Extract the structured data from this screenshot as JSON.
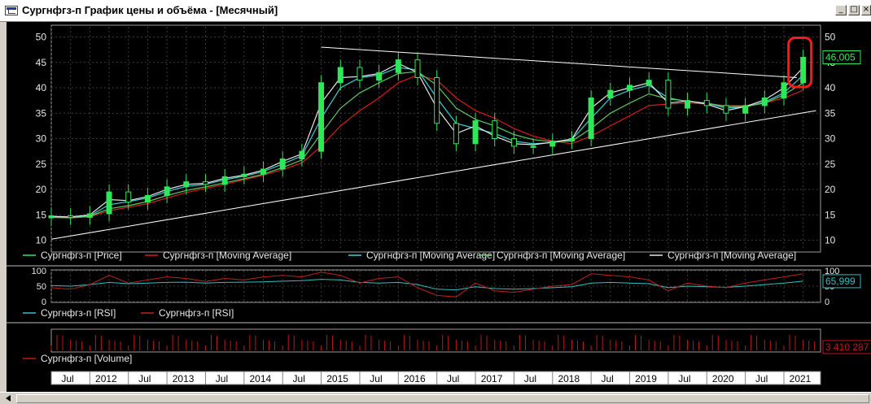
{
  "window": {
    "title": "Сургнфгз-п График цены и объёма - [Месячный]",
    "buttons": {
      "minimize": "_",
      "maximize": "□",
      "close": "×"
    }
  },
  "colors": {
    "background": "#000000",
    "grid": "#3a3a3a",
    "price": "#2ee85a",
    "ma_red": "#d81b1b",
    "ma_cyan": "#3ad0d8",
    "ma_green": "#5ec85e",
    "ma_white": "#e8e8e8",
    "trend": "#ffffff",
    "rsi_cyan": "#30c0c0",
    "rsi_red": "#c02020",
    "volume": "#c01818",
    "highlight": "#ff1a1a"
  },
  "chart_data": [
    {
      "type": "candlestick",
      "panel": "price",
      "y_ticks": [
        "50",
        "45",
        "40",
        "35",
        "30",
        "25",
        "20",
        "15",
        "10"
      ],
      "ylim": [
        8,
        52
      ],
      "grid": true,
      "last_value_label": "46,005",
      "x_dates": [
        "2011-07",
        "2011-10",
        "2012-01",
        "2012-04",
        "2012-07",
        "2012-10",
        "2013-01",
        "2013-04",
        "2013-07",
        "2013-10",
        "2014-01",
        "2014-04",
        "2014-07",
        "2014-10",
        "2015-01",
        "2015-04",
        "2015-07",
        "2015-10",
        "2016-01",
        "2016-04",
        "2016-07",
        "2016-10",
        "2017-01",
        "2017-04",
        "2017-07",
        "2017-10",
        "2018-01",
        "2018-04",
        "2018-07",
        "2018-10",
        "2019-01",
        "2019-04",
        "2019-07",
        "2019-10",
        "2020-01",
        "2020-04",
        "2020-07",
        "2020-10",
        "2021-01",
        "2021-04"
      ],
      "close": [
        14.8,
        14.5,
        15.2,
        19.5,
        17.5,
        18.8,
        20.5,
        21.5,
        21.0,
        22.5,
        23.0,
        24.0,
        26.0,
        27.5,
        41.0,
        44.0,
        41.5,
        43.0,
        45.5,
        42.0,
        33.0,
        29.0,
        33.5,
        30.0,
        28.5,
        28.5,
        29.5,
        30.0,
        38.0,
        39.5,
        40.5,
        41.5,
        36.0,
        37.5,
        36.5,
        35.0,
        36.5,
        38.0,
        41.0,
        46.0
      ],
      "series": [
        {
          "name": "Сургнфгз-п [Price]",
          "color": "#2ee85a"
        },
        {
          "name": "Сургнфгз-п [Moving Average]",
          "color": "#d81b1b",
          "values": [
            14.5,
            14.4,
            14.6,
            15.8,
            16.5,
            17.2,
            18.3,
            19.4,
            20.2,
            21.0,
            21.9,
            22.8,
            23.9,
            25.2,
            28.5,
            32.5,
            35.5,
            38.0,
            41.0,
            42.5,
            41.5,
            38.0,
            35.5,
            34.0,
            32.0,
            30.5,
            29.5,
            29.0,
            30.5,
            32.5,
            34.5,
            36.5,
            36.8,
            37.0,
            36.8,
            36.5,
            36.5,
            37.0,
            38.0,
            39.5
          ]
        },
        {
          "name": "Сургнфгз-п [Moving Average]",
          "color": "#3ad0d8",
          "values": [
            14.6,
            14.5,
            14.8,
            17.0,
            17.6,
            18.3,
            19.6,
            20.6,
            21.0,
            21.9,
            22.6,
            23.5,
            25.0,
            26.6,
            34.0,
            40.0,
            42.0,
            42.5,
            44.0,
            43.5,
            38.0,
            33.0,
            32.0,
            31.0,
            29.5,
            29.0,
            29.2,
            29.8,
            34.0,
            38.0,
            39.5,
            40.5,
            38.0,
            37.3,
            37.0,
            36.0,
            36.2,
            37.2,
            39.0,
            42.5
          ]
        },
        {
          "name": "Сургнфгз-п [Moving Average]",
          "color": "#5ec85e",
          "values": [
            14.5,
            14.4,
            14.7,
            16.2,
            16.8,
            17.6,
            18.8,
            19.8,
            20.5,
            21.3,
            22.1,
            23.0,
            24.3,
            25.8,
            31.0,
            36.0,
            39.0,
            41.0,
            42.8,
            43.2,
            40.5,
            36.0,
            33.8,
            32.5,
            30.8,
            29.8,
            29.4,
            29.5,
            32.0,
            35.0,
            37.0,
            38.8,
            37.8,
            37.4,
            37.0,
            36.3,
            36.3,
            37.0,
            38.6,
            41.0
          ]
        },
        {
          "name": "Сургнфгз-п [Moving Average]",
          "color": "#e8e8e8",
          "values": [
            14.7,
            14.6,
            15.0,
            18.0,
            17.8,
            18.6,
            20.0,
            21.0,
            21.2,
            22.2,
            22.8,
            23.8,
            25.5,
            27.0,
            37.0,
            42.0,
            42.2,
            42.8,
            44.8,
            43.0,
            36.0,
            31.0,
            32.5,
            30.5,
            29.0,
            28.8,
            29.3,
            29.9,
            36.0,
            39.0,
            40.0,
            41.0,
            37.0,
            37.4,
            36.8,
            35.5,
            36.3,
            37.6,
            40.0,
            44.0
          ]
        }
      ],
      "trendlines": [
        {
          "from": [
            "2011-07",
            10.2
          ],
          "to": [
            "2021-06",
            35.5
          ]
        },
        {
          "from": [
            "2015-01",
            48.0
          ],
          "to": [
            "2021-03",
            42.0
          ]
        }
      ],
      "annotation": "red rounded rectangle around latest candle"
    },
    {
      "type": "line",
      "panel": "rsi",
      "y_ticks": [
        "100",
        "50",
        "0"
      ],
      "ylim": [
        0,
        100
      ],
      "last_value_label": "65,999",
      "series": [
        {
          "name": "Сургнфгз-п [RSI]",
          "color": "#30c0c0",
          "values": [
            52,
            50,
            55,
            62,
            58,
            60,
            62,
            63,
            60,
            62,
            63,
            64,
            66,
            68,
            72,
            70,
            62,
            60,
            62,
            55,
            40,
            38,
            48,
            42,
            40,
            42,
            45,
            48,
            60,
            62,
            60,
            58,
            45,
            50,
            48,
            46,
            50,
            55,
            60,
            66
          ]
        },
        {
          "name": "Сургнфгз-п [RSI]",
          "color": "#c02020",
          "values": [
            45,
            40,
            55,
            85,
            60,
            70,
            80,
            75,
            65,
            75,
            70,
            80,
            85,
            80,
            95,
            85,
            60,
            75,
            80,
            45,
            20,
            15,
            60,
            35,
            30,
            40,
            50,
            55,
            90,
            85,
            80,
            70,
            35,
            60,
            50,
            45,
            60,
            70,
            80,
            90
          ]
        }
      ]
    },
    {
      "type": "bar",
      "panel": "volume",
      "last_value_label": "3 410 287",
      "series": [
        {
          "name": "Сургнфгз-п [Volume]",
          "color": "#c01818"
        }
      ]
    }
  ],
  "x_axis": {
    "labels": [
      "Jul",
      "2012",
      "Jul",
      "2013",
      "Jul",
      "2014",
      "Jul",
      "2015",
      "Jul",
      "2016",
      "Jul",
      "2017",
      "Jul",
      "2018",
      "Jul",
      "2019",
      "Jul",
      "2020",
      "Jul",
      "2021"
    ]
  }
}
